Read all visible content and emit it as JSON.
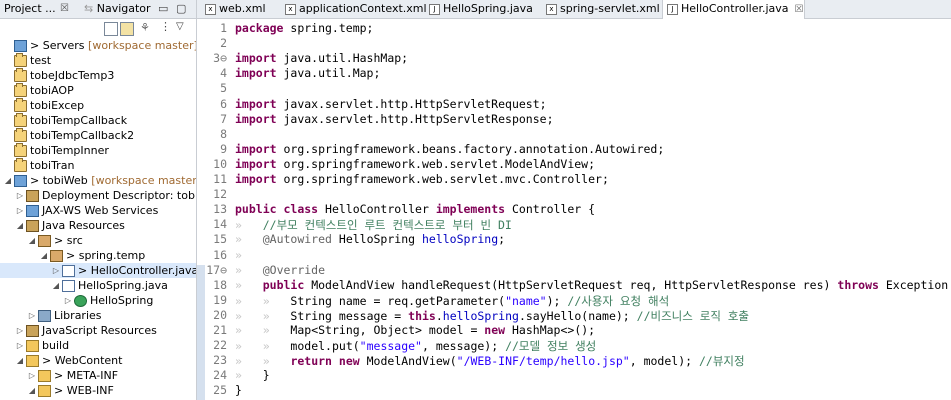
{
  "left_panel": {
    "tab_project": "Project ...",
    "tab_project_close": "☒",
    "tab_navigator": "Navigator",
    "tree": [
      {
        "label": "Servers",
        "decoration": "[workspace master]",
        "prefix": ">",
        "icon": "server-project-icon",
        "indent": 0,
        "twisty": ""
      },
      {
        "label": "test",
        "decoration": "",
        "prefix": "",
        "icon": "project-icon",
        "indent": 0,
        "twisty": ""
      },
      {
        "label": "tobeJdbcTemp3",
        "decoration": "",
        "prefix": "",
        "icon": "project-icon",
        "indent": 0,
        "twisty": ""
      },
      {
        "label": "tobiAOP",
        "decoration": "",
        "prefix": "",
        "icon": "project-icon",
        "indent": 0,
        "twisty": ""
      },
      {
        "label": "tobiExcep",
        "decoration": "",
        "prefix": "",
        "icon": "project-icon",
        "indent": 0,
        "twisty": ""
      },
      {
        "label": "tobiTempCallback",
        "decoration": "",
        "prefix": "",
        "icon": "project-icon",
        "indent": 0,
        "twisty": ""
      },
      {
        "label": "tobiTempCallback2",
        "decoration": "",
        "prefix": "",
        "icon": "project-icon",
        "indent": 0,
        "twisty": ""
      },
      {
        "label": "tobiTempInner",
        "decoration": "",
        "prefix": "",
        "icon": "project-icon",
        "indent": 0,
        "twisty": ""
      },
      {
        "label": "tobiTran",
        "decoration": "",
        "prefix": "",
        "icon": "project-icon",
        "indent": 0,
        "twisty": ""
      },
      {
        "label": "tobiWeb",
        "decoration": "[workspace master]",
        "prefix": ">",
        "icon": "web-project-icon",
        "indent": 0,
        "twisty": "◢"
      },
      {
        "label": "Deployment Descriptor: tobiWeb",
        "decoration": "",
        "prefix": "",
        "icon": "deployment-descriptor-icon",
        "indent": 1,
        "twisty": "▷"
      },
      {
        "label": "JAX-WS Web Services",
        "decoration": "",
        "prefix": "",
        "icon": "jaxws-icon",
        "indent": 1,
        "twisty": "▷"
      },
      {
        "label": "Java Resources",
        "decoration": "",
        "prefix": "",
        "icon": "java-resources-icon",
        "indent": 1,
        "twisty": "◢"
      },
      {
        "label": "src",
        "decoration": "",
        "prefix": ">",
        "icon": "source-folder-icon",
        "indent": 2,
        "twisty": "◢"
      },
      {
        "label": "spring.temp",
        "decoration": "",
        "prefix": ">",
        "icon": "package-icon",
        "indent": 3,
        "twisty": "◢"
      },
      {
        "label": "HelloController.java",
        "decoration": "",
        "prefix": ">",
        "icon": "java-file-icon",
        "indent": 4,
        "twisty": "▷",
        "selected": true
      },
      {
        "label": "HelloSpring.java",
        "decoration": "",
        "prefix": "",
        "icon": "java-file-icon",
        "indent": 4,
        "twisty": "◢"
      },
      {
        "label": "HelloSpring",
        "decoration": "",
        "prefix": "",
        "icon": "class-icon",
        "indent": 5,
        "twisty": "▷"
      },
      {
        "label": "Libraries",
        "decoration": "",
        "prefix": "",
        "icon": "libraries-icon",
        "indent": 2,
        "twisty": "▷"
      },
      {
        "label": "JavaScript Resources",
        "decoration": "",
        "prefix": "",
        "icon": "js-resources-icon",
        "indent": 1,
        "twisty": "▷"
      },
      {
        "label": "build",
        "decoration": "",
        "prefix": "",
        "icon": "folder-icon",
        "indent": 1,
        "twisty": "▷"
      },
      {
        "label": "WebContent",
        "decoration": "",
        "prefix": ">",
        "icon": "folder-icon",
        "indent": 1,
        "twisty": "◢"
      },
      {
        "label": "META-INF",
        "decoration": "",
        "prefix": ">",
        "icon": "folder-icon",
        "indent": 2,
        "twisty": "▷"
      },
      {
        "label": "WEB-INF",
        "decoration": "",
        "prefix": ">",
        "icon": "folder-icon",
        "indent": 2,
        "twisty": "◢"
      }
    ]
  },
  "editor": {
    "tabs": [
      {
        "label": "web.xml",
        "icon": "xml-file-icon",
        "active": false
      },
      {
        "label": "applicationContext.xml",
        "icon": "xml-file-icon",
        "active": false
      },
      {
        "label": "HelloSpring.java",
        "icon": "java-file-icon",
        "active": false
      },
      {
        "label": "spring-servlet.xml",
        "icon": "xml-file-icon",
        "active": false
      },
      {
        "label": "HelloController.java",
        "icon": "java-file-icon",
        "active": true
      }
    ],
    "lines": [
      {
        "n": "1",
        "html": "<span class='kw'>package</span> spring.temp;"
      },
      {
        "n": "2",
        "html": ""
      },
      {
        "n": "3⊖",
        "html": "<span class='kw'>import</span> java.util.HashMap;"
      },
      {
        "n": "4",
        "html": "<span class='kw'>import</span> java.util.Map;"
      },
      {
        "n": "5",
        "html": ""
      },
      {
        "n": "6",
        "html": "<span class='kw'>import</span> javax.servlet.http.HttpServletRequest;"
      },
      {
        "n": "7",
        "html": "<span class='kw'>import</span> javax.servlet.http.HttpServletResponse;"
      },
      {
        "n": "8",
        "html": ""
      },
      {
        "n": "9",
        "html": "<span class='kw'>import</span> org.springframework.beans.factory.annotation.Autowired;"
      },
      {
        "n": "10",
        "html": "<span class='kw'>import</span> org.springframework.web.servlet.ModelAndView;"
      },
      {
        "n": "11",
        "html": "<span class='kw'>import</span> org.springframework.web.servlet.mvc.Controller;"
      },
      {
        "n": "12",
        "html": ""
      },
      {
        "n": "13",
        "html": "<span class='kw'>public</span> <span class='kw'>class</span> HelloController <span class='kw'>implements</span> Controller {"
      },
      {
        "n": "14",
        "html": "<span class='wsp'>»</span>   <span class='cm'>//부모 컨텍스트인 루트 컨텍스트로 부터 빈 DI</span>"
      },
      {
        "n": "15",
        "html": "<span class='wsp'>»</span>   <span class='ann'>@Autowired</span> HelloSpring <span class='fld'>helloSpring</span>;"
      },
      {
        "n": "16",
        "html": "<span class='wsp'>»</span>"
      },
      {
        "n": "17⊖",
        "html": "<span class='wsp'>»</span>   <span class='ann'>@Override</span>"
      },
      {
        "n": "18",
        "html": "<span class='wsp'>»</span>   <span class='kw'>public</span> ModelAndView handleRequest(HttpServletRequest req, HttpServletResponse res) <span class='kw'>throws</span> Exception {"
      },
      {
        "n": "19",
        "html": "<span class='wsp'>»</span>   <span class='wsp'>»</span>   String name = req.getParameter(<span class='str'>\"name\"</span>); <span class='cm'>//사용자 요청 해석</span>"
      },
      {
        "n": "20",
        "html": "<span class='wsp'>»</span>   <span class='wsp'>»</span>   String message = <span class='kw'>this</span>.<span class='fld'>helloSpring</span>.sayHello(name); <span class='cm'>//비즈니스 로직 호출</span>"
      },
      {
        "n": "21",
        "html": "<span class='wsp'>»</span>   <span class='wsp'>»</span>   Map&lt;String, Object&gt; model = <span class='kw'>new</span> HashMap&lt;&gt;();"
      },
      {
        "n": "22",
        "html": "<span class='wsp'>»</span>   <span class='wsp'>»</span>   model.put(<span class='str'>\"message\"</span>, message); <span class='cm'>//모델 정보 생성</span>"
      },
      {
        "n": "23",
        "html": "<span class='wsp'>»</span>   <span class='wsp'>»</span>   <span class='kw'>return</span> <span class='kw'>new</span> ModelAndView(<span class='str'>\"/WEB-INF/temp/hello.jsp\"</span>, model); <span class='cm'>//뷰지정</span>"
      },
      {
        "n": "24",
        "html": "<span class='wsp'>»</span>   }"
      },
      {
        "n": "25",
        "html": "}"
      }
    ]
  },
  "colors": {
    "keyword": "#7f0055",
    "string": "#2a00ff",
    "comment": "#3f7f5f",
    "field": "#0000c0",
    "selection": "#d9e8fb",
    "decoration": "#a06a32"
  }
}
